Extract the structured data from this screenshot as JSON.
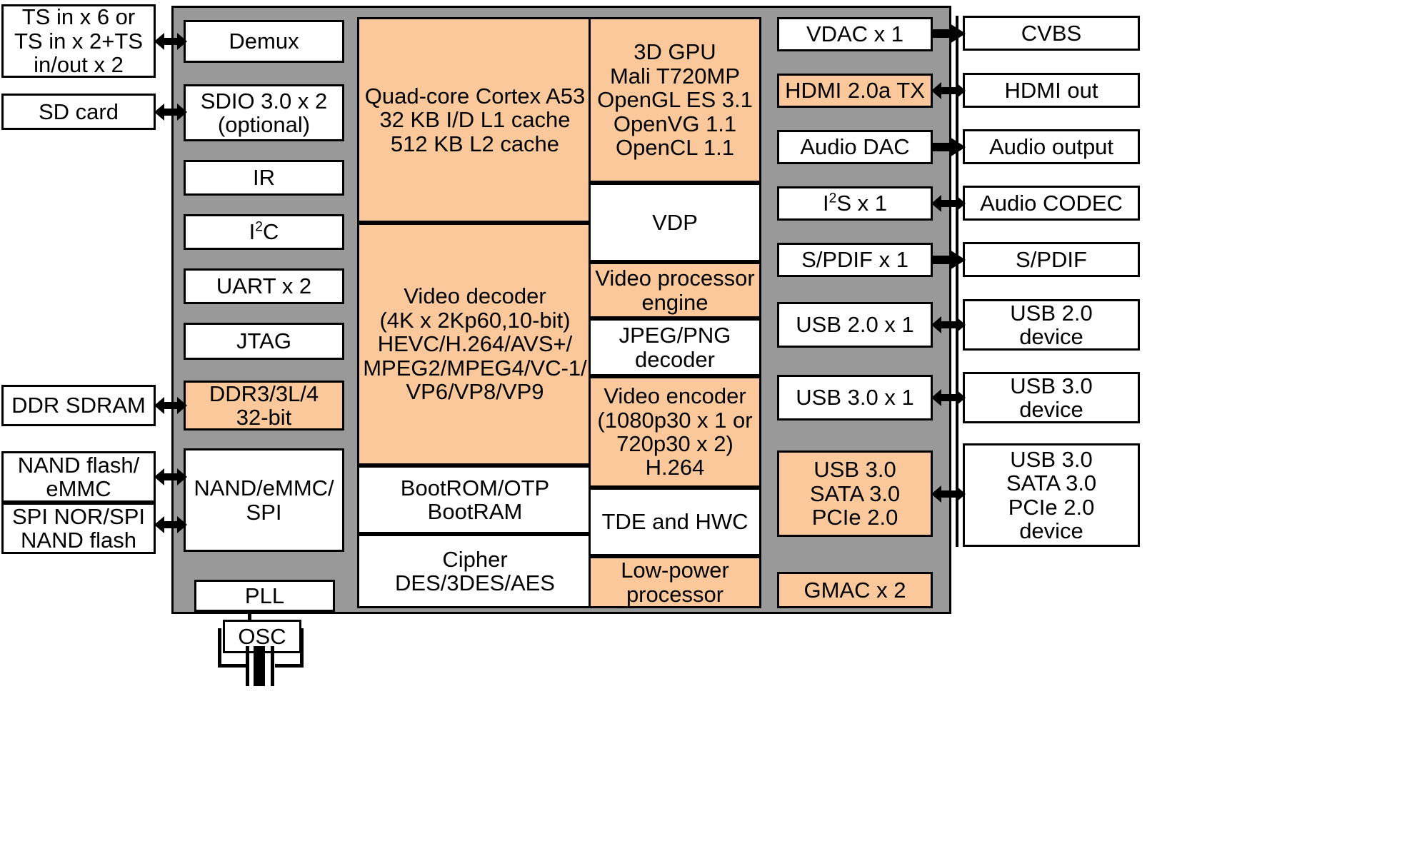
{
  "diagram": {
    "title": "SoC block diagram",
    "colors": {
      "soc_fill": "#999999",
      "block_fill": "#ffffff",
      "highlight_fill": "#fac89a",
      "stroke": "#000000"
    }
  },
  "external_left": [
    {
      "id": "ts-in",
      "label": "TS in x 6 or\nTS in x 2+TS\nin/out x 2"
    },
    {
      "id": "sd-card",
      "label": "SD card"
    },
    {
      "id": "ddr-sdram",
      "label": "DDR SDRAM"
    },
    {
      "id": "nand-flash-emmc",
      "label": "NAND flash/\neMMC"
    },
    {
      "id": "spi-nor-nand",
      "label": "SPI NOR/SPI\nNAND flash"
    }
  ],
  "soc_left_column": [
    {
      "id": "demux",
      "label": "Demux",
      "highlight": false
    },
    {
      "id": "sdio",
      "label": "SDIO 3.0 x 2\n(optional)",
      "highlight": false
    },
    {
      "id": "ir",
      "label": "IR",
      "highlight": false
    },
    {
      "id": "i2c",
      "label": "I2C",
      "label_html": "I<sup>2</sup>C",
      "highlight": false
    },
    {
      "id": "uart",
      "label": "UART x 2",
      "highlight": false
    },
    {
      "id": "jtag",
      "label": "JTAG",
      "highlight": false
    },
    {
      "id": "ddr-controller",
      "label": "DDR3/3L/4\n32-bit",
      "highlight": true
    },
    {
      "id": "nand-emmc-spi",
      "label": "NAND/eMMC/\nSPI",
      "highlight": false
    },
    {
      "id": "pll",
      "label": "PLL",
      "highlight": false
    }
  ],
  "soc_center_column": [
    {
      "id": "cpu",
      "label": "Quad-core Cortex A53\n32 KB I/D L1 cache\n512 KB L2 cache",
      "highlight": true
    },
    {
      "id": "video-decoder",
      "label": "Video decoder\n(4K x 2Kp60,10-bit)\nHEVC/H.264/AVS+/\nMPEG2/MPEG4/VC-1/\nVP6/VP8/VP9",
      "highlight": true
    },
    {
      "id": "bootrom",
      "label": "BootROM/OTP\nBootRAM",
      "highlight": false
    },
    {
      "id": "cipher",
      "label": "Cipher\nDES/3DES/AES",
      "highlight": false
    }
  ],
  "soc_media_column": [
    {
      "id": "gpu",
      "label": "3D GPU\nMali T720MP\nOpenGL ES 3.1\nOpenVG 1.1\nOpenCL 1.1",
      "highlight": true
    },
    {
      "id": "vdp",
      "label": "VDP",
      "highlight": false
    },
    {
      "id": "video-processor-engine",
      "label": "Video processor\nengine",
      "highlight": true
    },
    {
      "id": "jpeg-png-decoder",
      "label": "JPEG/PNG\ndecoder",
      "highlight": false
    },
    {
      "id": "video-encoder",
      "label": "Video encoder\n(1080p30 x 1 or\n720p30 x 2)\nH.264",
      "highlight": true
    },
    {
      "id": "tde-hwc",
      "label": "TDE and HWC",
      "highlight": false
    },
    {
      "id": "low-power-processor",
      "label": "Low-power\nprocessor",
      "highlight": true
    }
  ],
  "soc_right_column": [
    {
      "id": "vdac",
      "label": "VDAC x 1",
      "highlight": false
    },
    {
      "id": "hdmi-tx",
      "label": "HDMI 2.0a TX",
      "highlight": true
    },
    {
      "id": "audio-dac",
      "label": "Audio DAC",
      "highlight": false
    },
    {
      "id": "i2s",
      "label": "I2S x 1",
      "label_html": "I<sup>2</sup>S x 1",
      "highlight": false
    },
    {
      "id": "spdif",
      "label": "S/PDIF x 1",
      "highlight": false
    },
    {
      "id": "usb20",
      "label": "USB 2.0 x 1",
      "highlight": false
    },
    {
      "id": "usb30",
      "label": "USB 3.0 x 1",
      "highlight": false
    },
    {
      "id": "usb-sata-pcie",
      "label": "USB 3.0\nSATA 3.0\nPCIe 2.0",
      "highlight": true
    },
    {
      "id": "gmac",
      "label": "GMAC x 2",
      "highlight": true
    }
  ],
  "external_right": [
    {
      "id": "cvbs",
      "label": "CVBS"
    },
    {
      "id": "hdmi-out",
      "label": "HDMI out"
    },
    {
      "id": "audio-output",
      "label": "Audio output"
    },
    {
      "id": "audio-codec",
      "label": "Audio CODEC"
    },
    {
      "id": "spdif-out",
      "label": "S/PDIF"
    },
    {
      "id": "usb20-device",
      "label": "USB 2.0\ndevice"
    },
    {
      "id": "usb30-device",
      "label": "USB 3.0\ndevice"
    },
    {
      "id": "usb-sata-pcie-device",
      "label": "USB 3.0\nSATA 3.0\nPCIe 2.0\ndevice"
    }
  ],
  "external_bottom": [
    {
      "id": "osc",
      "label": "OSC"
    }
  ]
}
